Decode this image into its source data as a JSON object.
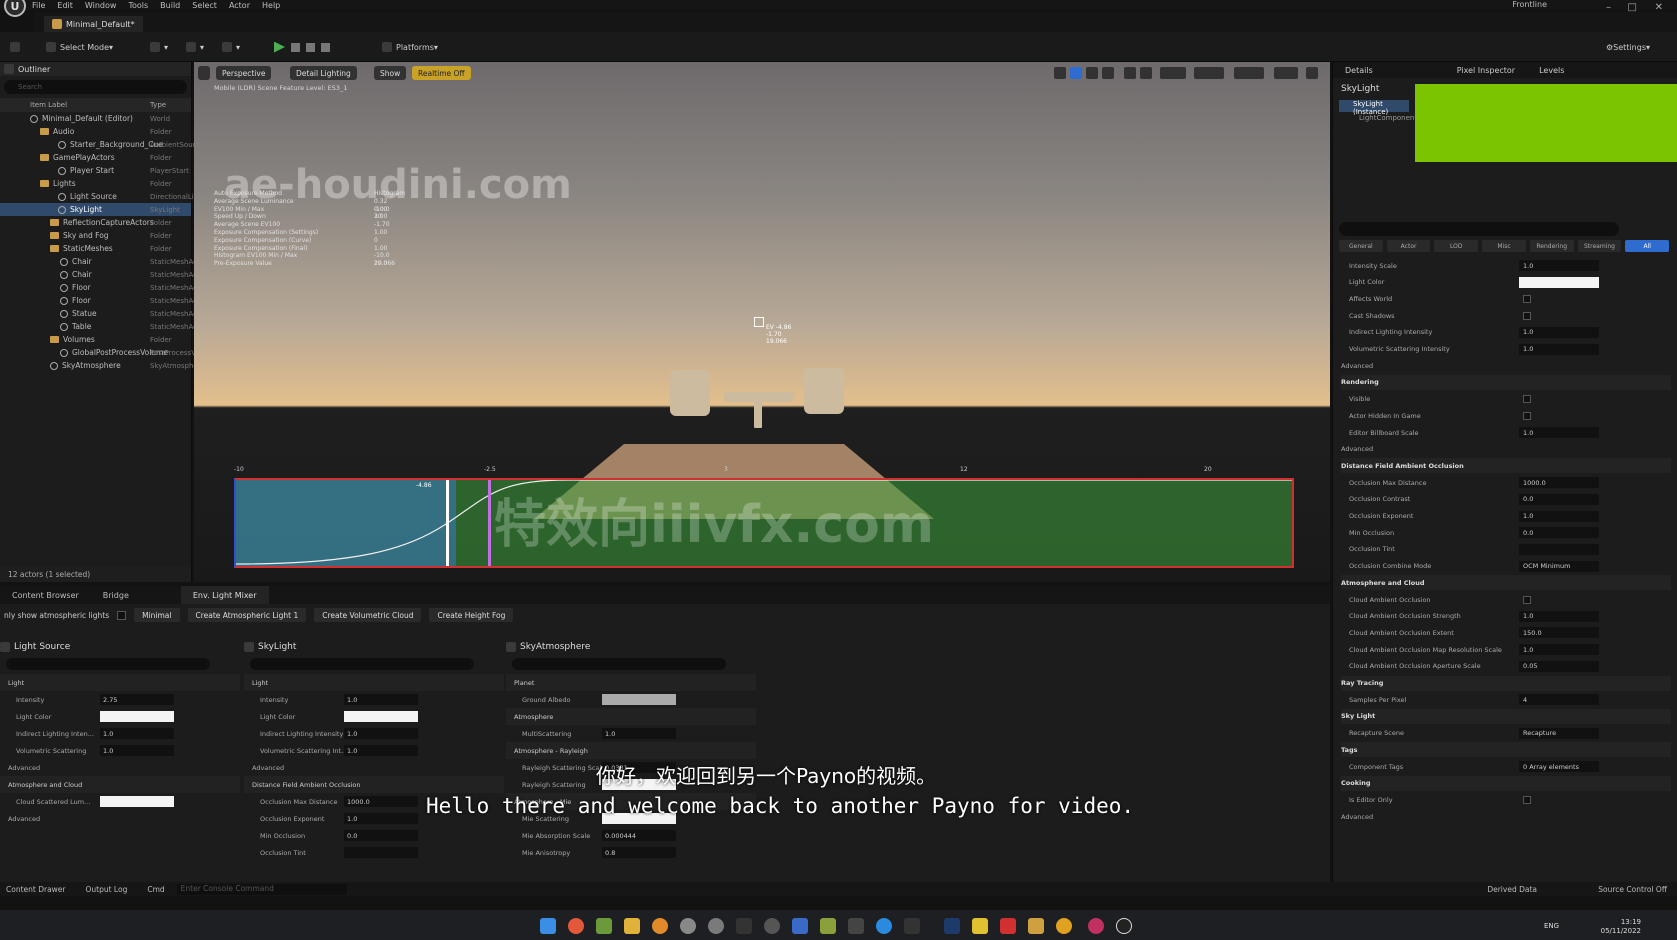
{
  "menu": [
    "File",
    "Edit",
    "Window",
    "Tools",
    "Build",
    "Select",
    "Actor",
    "Help"
  ],
  "logo": "U",
  "doc_tab": "Minimal_Default*",
  "top_right_label": "Frontline",
  "window_controls": [
    "–",
    "□",
    "✕"
  ],
  "toolbar": {
    "select_mode": "Select Mode",
    "platforms": "Platforms",
    "settings": "Settings"
  },
  "outliner": {
    "tab": "Outliner",
    "search_placeholder": "Search",
    "col_label": "Item Label",
    "col_type": "Type",
    "rows": [
      {
        "label": "Minimal_Default (Editor)",
        "type": "World",
        "indent": 30,
        "kind": "obj",
        "sel": false
      },
      {
        "label": "Audio",
        "type": "Folder",
        "indent": 40,
        "kind": "folder",
        "sel": false
      },
      {
        "label": "Starter_Background_Cue",
        "type": "AmbientSound",
        "indent": 58,
        "kind": "obj",
        "sel": false
      },
      {
        "label": "GamePlayActors",
        "type": "Folder",
        "indent": 40,
        "kind": "folder",
        "sel": false
      },
      {
        "label": "Player Start",
        "type": "PlayerStart",
        "indent": 58,
        "kind": "obj",
        "sel": false
      },
      {
        "label": "Lights",
        "type": "Folder",
        "indent": 40,
        "kind": "folder",
        "sel": false
      },
      {
        "label": "Light Source",
        "type": "DirectionalLight",
        "indent": 58,
        "kind": "obj",
        "sel": false
      },
      {
        "label": "SkyLight",
        "type": "SkyLight",
        "indent": 58,
        "kind": "obj",
        "sel": true
      },
      {
        "label": "ReflectionCaptureActors",
        "type": "Folder",
        "indent": 50,
        "kind": "folder",
        "sel": false
      },
      {
        "label": "Sky and Fog",
        "type": "Folder",
        "indent": 50,
        "kind": "folder",
        "sel": false
      },
      {
        "label": "StaticMeshes",
        "type": "Folder",
        "indent": 50,
        "kind": "folder",
        "sel": false
      },
      {
        "label": "Chair",
        "type": "StaticMeshActor",
        "indent": 60,
        "kind": "obj",
        "sel": false
      },
      {
        "label": "Chair",
        "type": "StaticMeshActor",
        "indent": 60,
        "kind": "obj",
        "sel": false
      },
      {
        "label": "Floor",
        "type": "StaticMeshActor",
        "indent": 60,
        "kind": "obj",
        "sel": false
      },
      {
        "label": "Floor",
        "type": "StaticMeshActor",
        "indent": 60,
        "kind": "obj",
        "sel": false
      },
      {
        "label": "Statue",
        "type": "StaticMeshActor",
        "indent": 60,
        "kind": "obj",
        "sel": false
      },
      {
        "label": "Table",
        "type": "StaticMeshActor",
        "indent": 60,
        "kind": "obj",
        "sel": false
      },
      {
        "label": "Volumes",
        "type": "Folder",
        "indent": 50,
        "kind": "folder",
        "sel": false
      },
      {
        "label": "GlobalPostProcessVolume",
        "type": "PostProcessVolume",
        "indent": 60,
        "kind": "obj",
        "sel": false
      },
      {
        "label": "SkyAtmosphere",
        "type": "SkyAtmosphere",
        "indent": 50,
        "kind": "obj",
        "sel": false
      }
    ],
    "status": "12 actors (1 selected)"
  },
  "viewport": {
    "perspective": "Perspective",
    "lighting": "Detail Lighting",
    "show": "Show",
    "realtime": "Realtime Off",
    "info": "Mobile (LDR) Scene   Feature Level: ES3_1",
    "watermark1": "ae-houdini.com",
    "watermark2": "特效向iiivfx.com",
    "stats": [
      {
        "k": "Auto Exposure Method",
        "v": "Histogram"
      },
      {
        "k": "Average Scene Luminance",
        "v": "0.32     0.00"
      },
      {
        "k": "EV100 Min / Max",
        "v": "-10.0    20.0"
      },
      {
        "k": "Speed Up / Down",
        "v": "3.0"
      },
      {
        "k": "Average Scene EV100",
        "v": "-1.70"
      },
      {
        "k": "Exposure Compensation (Settings)",
        "v": "1.00"
      },
      {
        "k": "Exposure Compensation (Curve)",
        "v": "0"
      },
      {
        "k": "Exposure Compensation (Final)",
        "v": "1.00"
      },
      {
        "k": "Histogram EV100 Min / Max",
        "v": "-10.0    20.0"
      },
      {
        "k": "Pre-Exposure Value",
        "v": "19.066"
      }
    ],
    "scale": [
      "-10",
      "-2.5",
      "3",
      "12",
      "20"
    ],
    "curve_marker": "-4.86",
    "crosshair_label": "EV -4.86\n-1.70\n19.066"
  },
  "details": {
    "tabs": [
      "Details",
      "Pixel Inspector",
      "Levels"
    ],
    "title": "SkyLight",
    "instance": "SkyLight (Instance)",
    "component": "LightComponent",
    "categories": [
      "General",
      "Actor",
      "LOD",
      "Misc",
      "Rendering",
      "Streaming",
      "All"
    ],
    "props": [
      {
        "k": "Intensity Scale",
        "v": "1.0",
        "t": "num"
      },
      {
        "k": "Light Color",
        "v": "",
        "t": "color"
      },
      {
        "k": "Affects World",
        "v": "",
        "t": "chk"
      },
      {
        "k": "Cast Shadows",
        "v": "",
        "t": "chk"
      },
      {
        "k": "Indirect Lighting Intensity",
        "v": "1.0",
        "t": "num"
      },
      {
        "k": "Volumetric Scattering Intensity",
        "v": "1.0",
        "t": "num"
      },
      {
        "k": "Advanced",
        "v": "",
        "t": "sub"
      },
      {
        "k": "Rendering",
        "v": "",
        "t": "sec"
      },
      {
        "k": "Visible",
        "v": "",
        "t": "chk"
      },
      {
        "k": "Actor Hidden In Game",
        "v": "",
        "t": "chk"
      },
      {
        "k": "Editor Billboard Scale",
        "v": "1.0",
        "t": "num"
      },
      {
        "k": "Advanced",
        "v": "",
        "t": "sub"
      },
      {
        "k": "Distance Field Ambient Occlusion",
        "v": "",
        "t": "sec"
      },
      {
        "k": "Occlusion Max Distance",
        "v": "1000.0",
        "t": "num"
      },
      {
        "k": "Occlusion Contrast",
        "v": "0.0",
        "t": "num"
      },
      {
        "k": "Occlusion Exponent",
        "v": "1.0",
        "t": "num"
      },
      {
        "k": "Min Occlusion",
        "v": "0.0",
        "t": "num"
      },
      {
        "k": "Occlusion Tint",
        "v": "",
        "t": "dark"
      },
      {
        "k": "Occlusion Combine Mode",
        "v": "OCM Minimum",
        "t": "num"
      },
      {
        "k": "Atmosphere and Cloud",
        "v": "",
        "t": "sec"
      },
      {
        "k": "Cloud Ambient Occlusion",
        "v": "",
        "t": "chk"
      },
      {
        "k": "Cloud Ambient Occlusion Strength",
        "v": "1.0",
        "t": "num"
      },
      {
        "k": "Cloud Ambient Occlusion Extent",
        "v": "150.0",
        "t": "num"
      },
      {
        "k": "Cloud Ambient Occlusion Map Resolution Scale",
        "v": "1.0",
        "t": "num"
      },
      {
        "k": "Cloud Ambient Occlusion Aperture Scale",
        "v": "0.05",
        "t": "num"
      },
      {
        "k": "Ray Tracing",
        "v": "",
        "t": "sec"
      },
      {
        "k": "Samples Per Pixel",
        "v": "4",
        "t": "num"
      },
      {
        "k": "Sky Light",
        "v": "",
        "t": "sec"
      },
      {
        "k": "Recapture Scene",
        "v": "Recapture",
        "t": "num"
      },
      {
        "k": "Tags",
        "v": "",
        "t": "sec"
      },
      {
        "k": "Component Tags",
        "v": "0 Array elements",
        "t": "num"
      },
      {
        "k": "Cooking",
        "v": "",
        "t": "sec"
      },
      {
        "k": "Is Editor Only",
        "v": "",
        "t": "chk"
      },
      {
        "k": "Advanced",
        "v": "",
        "t": "sub"
      }
    ]
  },
  "bottom": {
    "tabs": [
      "Content Browser",
      "Bridge",
      "Env. Light Mixer"
    ],
    "only_show": "nly show atmospheric lights",
    "minimal": "Minimal",
    "buttons": [
      "Create Atmospheric Light 1",
      "Create Volumetric Cloud",
      "Create Height Fog"
    ],
    "columns": [
      {
        "title": "Light Source",
        "props": [
          {
            "k": "Light",
            "v": "",
            "t": "sec"
          },
          {
            "k": "Intensity",
            "v": "2.75",
            "t": "num"
          },
          {
            "k": "Light Color",
            "v": "",
            "t": "color"
          },
          {
            "k": "Indirect Lighting Inten...",
            "v": "1.0",
            "t": "num"
          },
          {
            "k": "Volumetric Scattering",
            "v": "1.0",
            "t": "num"
          },
          {
            "k": "Advanced",
            "v": "",
            "t": "sub"
          },
          {
            "k": "Atmosphere and Cloud",
            "v": "",
            "t": "sec"
          },
          {
            "k": "Cloud Scattered Lum...",
            "v": "",
            "t": "color"
          },
          {
            "k": "Advanced",
            "v": "",
            "t": "sub"
          }
        ]
      },
      {
        "title": "SkyLight",
        "props": [
          {
            "k": "Light",
            "v": "",
            "t": "sec"
          },
          {
            "k": "Intensity",
            "v": "1.0",
            "t": "num"
          },
          {
            "k": "Light Color",
            "v": "",
            "t": "color"
          },
          {
            "k": "Indirect Lighting Intensity",
            "v": "1.0",
            "t": "num"
          },
          {
            "k": "Volumetric Scattering Int...",
            "v": "1.0",
            "t": "num"
          },
          {
            "k": "Advanced",
            "v": "",
            "t": "sub"
          },
          {
            "k": "Distance Field Ambient Occlusion",
            "v": "",
            "t": "sec"
          },
          {
            "k": "Occlusion Max Distance",
            "v": "1000.0",
            "t": "num"
          },
          {
            "k": "Occlusion Exponent",
            "v": "1.0",
            "t": "num"
          },
          {
            "k": "Min Occlusion",
            "v": "0.0",
            "t": "num"
          },
          {
            "k": "Occlusion Tint",
            "v": "",
            "t": "dark"
          }
        ]
      },
      {
        "title": "SkyAtmosphere",
        "props": [
          {
            "k": "Planet",
            "v": "",
            "t": "sec"
          },
          {
            "k": "Ground Albedo",
            "v": "",
            "t": "gray"
          },
          {
            "k": "Atmosphere",
            "v": "",
            "t": "sec"
          },
          {
            "k": "MultiScattering",
            "v": "1.0",
            "t": "num"
          },
          {
            "k": "Atmosphere - Rayleigh",
            "v": "",
            "t": "sec"
          },
          {
            "k": "Rayleigh Scattering Scale",
            "v": "0.0331",
            "t": "num"
          },
          {
            "k": "Rayleigh Scattering",
            "v": "",
            "t": "color"
          },
          {
            "k": "Atmosphere - Mie",
            "v": "",
            "t": "sec"
          },
          {
            "k": "Mie Scattering",
            "v": "",
            "t": "color"
          },
          {
            "k": "Mie Absorption Scale",
            "v": "0.000444",
            "t": "num"
          },
          {
            "k": "Mie Anisotropy",
            "v": "0.8",
            "t": "num"
          }
        ]
      }
    ]
  },
  "subtitles": {
    "cn": "你好，欢迎回到另一个Payno的视频。",
    "en": "Hello there and welcome back to another Payno for video."
  },
  "status": {
    "content_drawer": "Content Drawer",
    "output_log": "Output Log",
    "cmd": "Cmd",
    "cmd_placeholder": "Enter Console Command",
    "derived": "Derived Data",
    "source": "Source Control Off"
  },
  "taskbar": {
    "lang": "ENG",
    "time": "13:19",
    "date": "05/11/2022"
  }
}
